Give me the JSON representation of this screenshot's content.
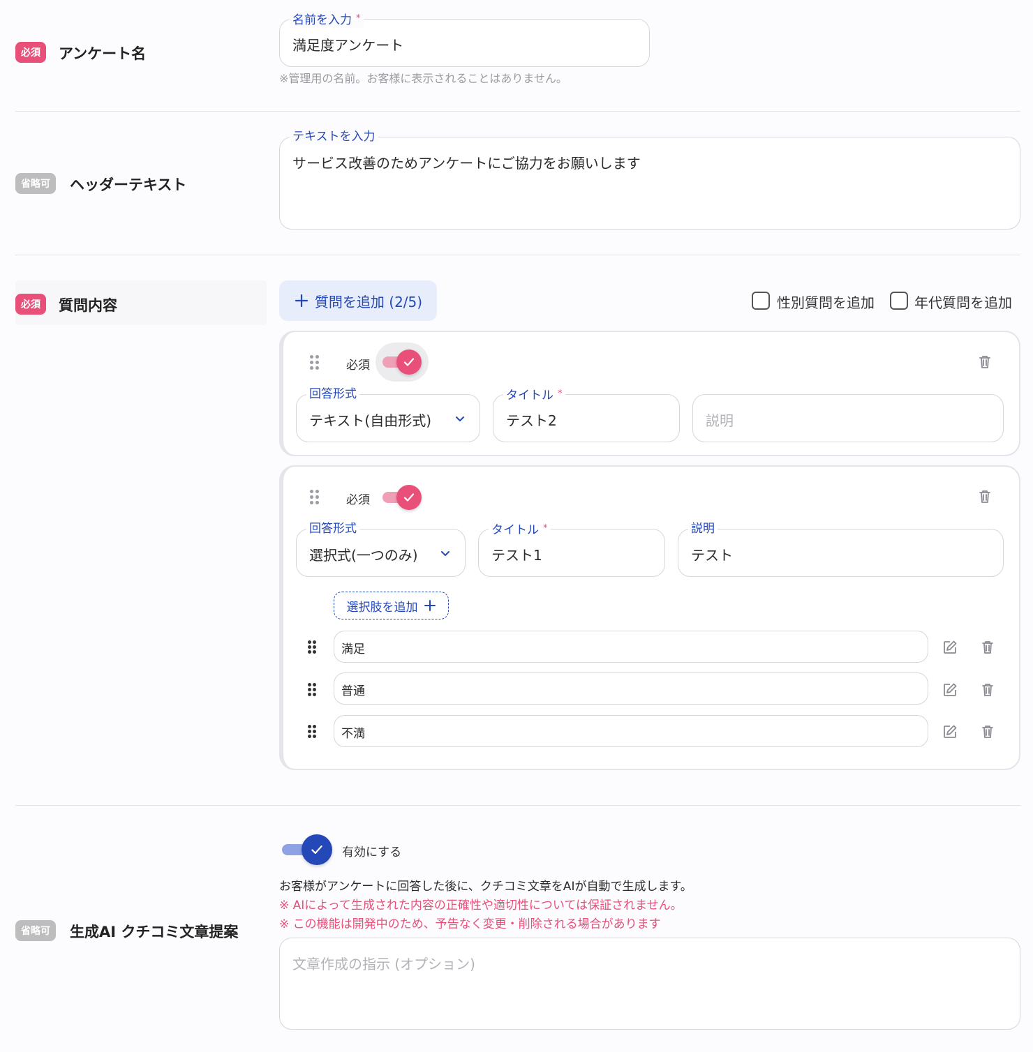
{
  "survey_name": {
    "badge": "必須",
    "label": "アンケート名",
    "field_label": "名前を入力",
    "required_mark": "*",
    "value": "満足度アンケート",
    "hint": "※管理用の名前。お客様に表示されることはありません。"
  },
  "header_text": {
    "badge": "省略可",
    "label": "ヘッダーテキスト",
    "field_label": "テキストを入力",
    "value": "サービス改善のためアンケートにご協力をお願いします"
  },
  "questions": {
    "badge": "必須",
    "label": "質問内容",
    "add_button": "質問を追加 (2/5)",
    "gender_checkbox": {
      "label": "性別質問を追加",
      "checked": false
    },
    "age_checkbox": {
      "label": "年代質問を追加",
      "checked": false
    },
    "items": [
      {
        "required_label": "必須",
        "required_on": true,
        "answer_type_label": "回答形式",
        "answer_type": "テキスト(自由形式)",
        "title_label": "タイトル",
        "title_required": "*",
        "title": "テスト2",
        "description_placeholder": "説明"
      },
      {
        "required_label": "必須",
        "required_on": true,
        "answer_type_label": "回答形式",
        "answer_type": "選択式(一つのみ)",
        "title_label": "タイトル",
        "title_required": "*",
        "title": "テスト1",
        "description_label": "説明",
        "description": "テスト",
        "add_option_button": "選択肢を追加",
        "options": [
          "満足",
          "普通",
          "不満"
        ]
      }
    ]
  },
  "ai_review": {
    "badge": "省略可",
    "label": "生成AI クチコミ文章提案",
    "toggle_label": "有効にする",
    "toggle_on": true,
    "description": "お客様がアンケートに回答した後に、クチコミ文章をAIが自動で生成します。",
    "warning1": "※ AIによって生成された内容の正確性や適切性については保証されません。",
    "warning2": "※ この機能は開発中のため、予告なく変更・削除される場合があります",
    "instruction_placeholder": "文章作成の指示 (オプション)"
  },
  "colors": {
    "accent_pink": "#e8507a",
    "accent_blue": "#2448b8",
    "optional_gray": "#bdbdbd"
  },
  "icons": [
    "drag-handle-icon",
    "check-icon",
    "trash-icon",
    "chevron-down-icon",
    "plus-icon",
    "edit-icon"
  ]
}
